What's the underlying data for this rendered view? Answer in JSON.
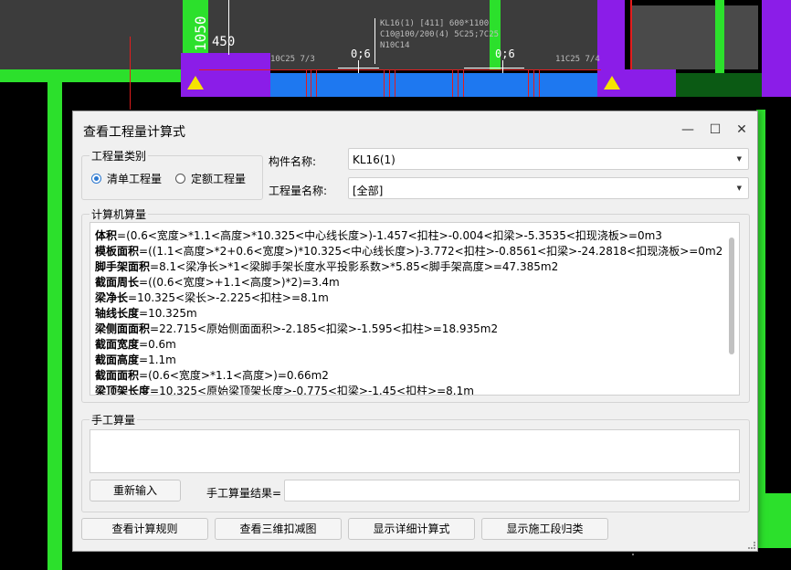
{
  "cad": {
    "beam_label_lines": [
      "KL16(1) [411] 600*1100",
      "C10@100/200(4) 5C25;7C25",
      "N10C14"
    ],
    "dim_1050": "1050",
    "dim_450": "450",
    "rebar_left": "10C25 7/3",
    "rebar_right": "11C25 7/4",
    "mark_1": "0;6",
    "mark_2": "0;6"
  },
  "dialog": {
    "title": "查看工程量计算式",
    "minimize": "—",
    "maximize": "☐",
    "close": "✕",
    "type_group": {
      "label": "工程量类别",
      "option_1": "清单工程量",
      "option_2": "定额工程量",
      "selected": "清单工程量"
    },
    "component_label": "构件名称:",
    "component_value": "KL16(1)",
    "quantity_label": "工程量名称:",
    "quantity_value": "[全部]",
    "calc_group_label": "计算机算量",
    "calc_lines": [
      {
        "name": "体积",
        "expr": "=(0.6<宽度>*1.1<高度>*10.325<中心线长度>)-1.457<扣柱>-0.004<扣梁>-5.3535<扣现浇板>=0m3"
      },
      {
        "name": "模板面积",
        "expr": "=((1.1<高度>*2+0.6<宽度>)*10.325<中心线长度>)-3.772<扣柱>-0.8561<扣梁>-24.2818<扣现浇板>=0m2"
      },
      {
        "name": "脚手架面积",
        "expr": "=8.1<梁净长>*1<梁脚手架长度水平投影系数>*5.85<脚手架高度>=47.385m2"
      },
      {
        "name": "截面周长",
        "expr": "=((0.6<宽度>+1.1<高度>)*2)=3.4m"
      },
      {
        "name": "梁净长",
        "expr": "=10.325<梁长>-2.225<扣柱>=8.1m"
      },
      {
        "name": "轴线长度",
        "expr": "=10.325m"
      },
      {
        "name": "梁侧面面积",
        "expr": "=22.715<原始侧面面积>-2.185<扣梁>-1.595<扣柱>=18.935m2"
      },
      {
        "name": "截面宽度",
        "expr": "=0.6m"
      },
      {
        "name": "截面高度",
        "expr": "=1.1m"
      },
      {
        "name": "截面面积",
        "expr": "=(0.6<宽度>*1.1<高度>)=0.66m2"
      },
      {
        "name": "梁顶架长度",
        "expr": "=10.325<原始梁顶架长度>-0.775<扣梁>-1.45<扣柱>=8.1m"
      }
    ],
    "manual_group_label": "手工算量",
    "reenter_button": "重新输入",
    "manual_result_label": "手工算量结果=",
    "manual_result_value": "",
    "buttons": {
      "rules": "查看计算规则",
      "view3d": "查看三维扣减图",
      "detail": "显示详细计算式",
      "segments": "显示施工段归类"
    }
  }
}
